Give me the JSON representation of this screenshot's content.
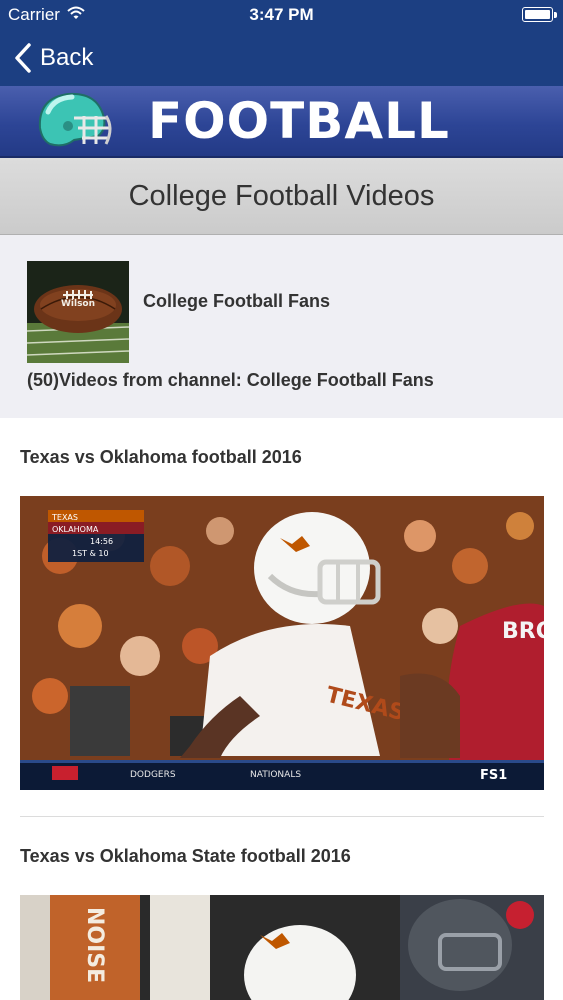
{
  "status_bar": {
    "carrier": "Carrier",
    "time": "3:47 PM"
  },
  "nav": {
    "back_label": "Back"
  },
  "banner": {
    "title": "FOOTBALL"
  },
  "section": {
    "title": "College Football Videos"
  },
  "channel": {
    "name": "College Football Fans",
    "videos_text": "(50)Videos from channel: College Football Fans",
    "ball_text": "Wilson"
  },
  "videos": [
    {
      "title": "Texas vs Oklahoma football 2016",
      "scorebug": {
        "team1": "TEXAS",
        "team2": "OKLAHOMA",
        "clock": "14:56",
        "down": "1ST & 10"
      },
      "ticker": {
        "left": "DODGERS",
        "right": "NATIONALS",
        "network": "FS1"
      },
      "jersey_text": "TEXAS",
      "opponent_text": "BRO"
    },
    {
      "title": "Texas vs Oklahoma State football 2016",
      "sign_text": "NOISE"
    }
  ],
  "colors": {
    "nav": "#1c3f82",
    "banner": "#2d4596",
    "panel": "#efeff4"
  }
}
